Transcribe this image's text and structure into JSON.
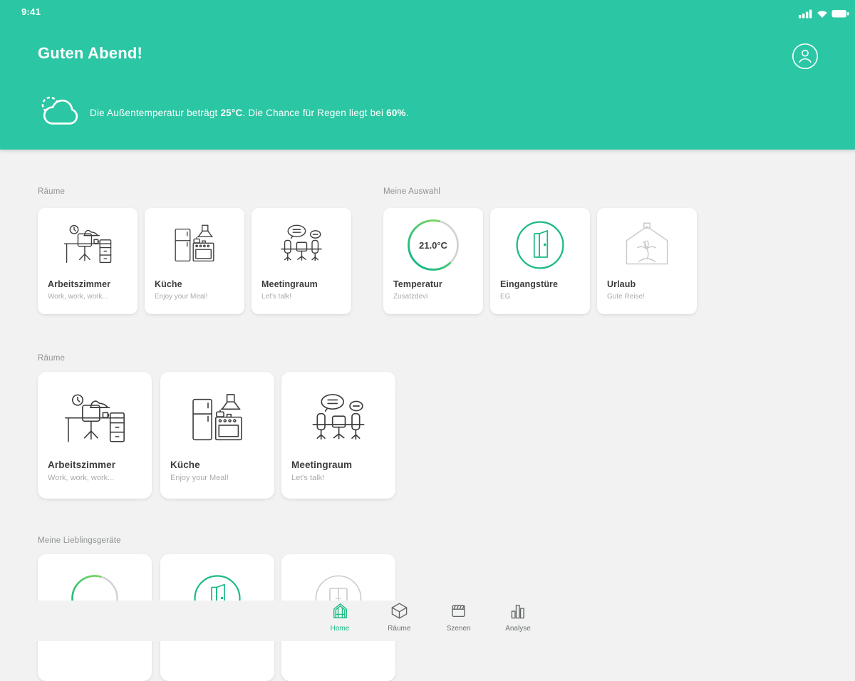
{
  "colors": {
    "header_teal": "#2BC6A3",
    "accent_green": "#1DBA83",
    "dial_green_start": "#7ED957",
    "dial_green_end": "#12B886",
    "page_bg": "#F1F2F1",
    "card_bg": "#FFFFFF",
    "title_text": "#3C3C3B",
    "muted_text": "#A8ACAB"
  },
  "status_bar": {
    "time": "9:41",
    "icons": [
      "signal-bars",
      "wifi",
      "battery-full"
    ]
  },
  "header": {
    "greeting": "Guten Abend!",
    "profile_icon": "person-circle",
    "weather": {
      "icon": "sun-behind-cloud",
      "before_temp": "Die Außentemperatur beträgt ",
      "temp": "25°C",
      "between": ". Die Chance für Regen liegt bei ",
      "rain": "60%",
      "after": "."
    }
  },
  "sections": [
    {
      "label": "Räume",
      "cards": [
        {
          "title": "Arbeitszimmer",
          "subtitle": "Work, work, work...",
          "icon": "home-office-desk"
        },
        {
          "title": "Küche",
          "subtitle": "Enjoy your Meal!",
          "icon": "kitchen"
        },
        {
          "title": "Meetingraum",
          "subtitle": "Let's talk!",
          "icon": "meeting-chairs"
        }
      ]
    },
    {
      "label": "Meine Auswahl",
      "cards": [
        {
          "title": "Temperatur",
          "subtitle": "Zusatzdevi",
          "value": "21.0°C",
          "icon": "temperature-ring"
        },
        {
          "title": "Eingangstüre",
          "subtitle": "EG",
          "icon": "open-door-circle"
        },
        {
          "title": "Urlaub",
          "subtitle": "Gute Reise!",
          "icon": "vacation-palm-house"
        }
      ]
    },
    {
      "label": "Räume",
      "cards": [
        {
          "title": "Arbeitszimmer",
          "subtitle": "Work, work, work...",
          "icon": "home-office-desk"
        },
        {
          "title": "Küche",
          "subtitle": "Enjoy your Meal!",
          "icon": "kitchen"
        },
        {
          "title": "Meetingraum",
          "subtitle": "Let's talk!",
          "icon": "meeting-chairs"
        }
      ]
    },
    {
      "label": "Meine Lieblingsgeräte",
      "cards": [
        {
          "icon": "temperature-ring"
        },
        {
          "icon": "open-door-circle"
        },
        {
          "icon": "double-door-circle"
        }
      ]
    }
  ],
  "tab_bar": {
    "tabs": [
      {
        "label": "Home",
        "icon": "greenhouse",
        "active": true
      },
      {
        "label": "Räume",
        "icon": "cube",
        "active": false
      },
      {
        "label": "Szenen",
        "icon": "clapperboard",
        "active": false
      },
      {
        "label": "Analyse",
        "icon": "bar-chart",
        "active": false
      }
    ]
  }
}
